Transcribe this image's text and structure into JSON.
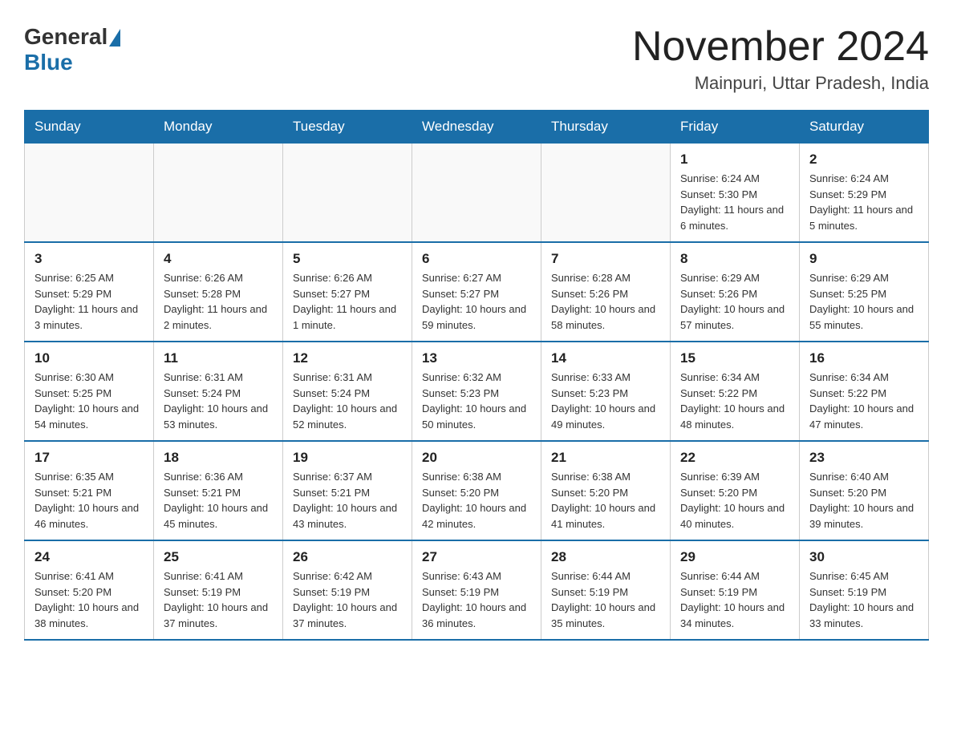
{
  "header": {
    "logo_general": "General",
    "logo_blue": "Blue",
    "month_title": "November 2024",
    "location": "Mainpuri, Uttar Pradesh, India"
  },
  "weekdays": [
    "Sunday",
    "Monday",
    "Tuesday",
    "Wednesday",
    "Thursday",
    "Friday",
    "Saturday"
  ],
  "weeks": [
    [
      {
        "day": "",
        "info": ""
      },
      {
        "day": "",
        "info": ""
      },
      {
        "day": "",
        "info": ""
      },
      {
        "day": "",
        "info": ""
      },
      {
        "day": "",
        "info": ""
      },
      {
        "day": "1",
        "info": "Sunrise: 6:24 AM\nSunset: 5:30 PM\nDaylight: 11 hours and 6 minutes."
      },
      {
        "day": "2",
        "info": "Sunrise: 6:24 AM\nSunset: 5:29 PM\nDaylight: 11 hours and 5 minutes."
      }
    ],
    [
      {
        "day": "3",
        "info": "Sunrise: 6:25 AM\nSunset: 5:29 PM\nDaylight: 11 hours and 3 minutes."
      },
      {
        "day": "4",
        "info": "Sunrise: 6:26 AM\nSunset: 5:28 PM\nDaylight: 11 hours and 2 minutes."
      },
      {
        "day": "5",
        "info": "Sunrise: 6:26 AM\nSunset: 5:27 PM\nDaylight: 11 hours and 1 minute."
      },
      {
        "day": "6",
        "info": "Sunrise: 6:27 AM\nSunset: 5:27 PM\nDaylight: 10 hours and 59 minutes."
      },
      {
        "day": "7",
        "info": "Sunrise: 6:28 AM\nSunset: 5:26 PM\nDaylight: 10 hours and 58 minutes."
      },
      {
        "day": "8",
        "info": "Sunrise: 6:29 AM\nSunset: 5:26 PM\nDaylight: 10 hours and 57 minutes."
      },
      {
        "day": "9",
        "info": "Sunrise: 6:29 AM\nSunset: 5:25 PM\nDaylight: 10 hours and 55 minutes."
      }
    ],
    [
      {
        "day": "10",
        "info": "Sunrise: 6:30 AM\nSunset: 5:25 PM\nDaylight: 10 hours and 54 minutes."
      },
      {
        "day": "11",
        "info": "Sunrise: 6:31 AM\nSunset: 5:24 PM\nDaylight: 10 hours and 53 minutes."
      },
      {
        "day": "12",
        "info": "Sunrise: 6:31 AM\nSunset: 5:24 PM\nDaylight: 10 hours and 52 minutes."
      },
      {
        "day": "13",
        "info": "Sunrise: 6:32 AM\nSunset: 5:23 PM\nDaylight: 10 hours and 50 minutes."
      },
      {
        "day": "14",
        "info": "Sunrise: 6:33 AM\nSunset: 5:23 PM\nDaylight: 10 hours and 49 minutes."
      },
      {
        "day": "15",
        "info": "Sunrise: 6:34 AM\nSunset: 5:22 PM\nDaylight: 10 hours and 48 minutes."
      },
      {
        "day": "16",
        "info": "Sunrise: 6:34 AM\nSunset: 5:22 PM\nDaylight: 10 hours and 47 minutes."
      }
    ],
    [
      {
        "day": "17",
        "info": "Sunrise: 6:35 AM\nSunset: 5:21 PM\nDaylight: 10 hours and 46 minutes."
      },
      {
        "day": "18",
        "info": "Sunrise: 6:36 AM\nSunset: 5:21 PM\nDaylight: 10 hours and 45 minutes."
      },
      {
        "day": "19",
        "info": "Sunrise: 6:37 AM\nSunset: 5:21 PM\nDaylight: 10 hours and 43 minutes."
      },
      {
        "day": "20",
        "info": "Sunrise: 6:38 AM\nSunset: 5:20 PM\nDaylight: 10 hours and 42 minutes."
      },
      {
        "day": "21",
        "info": "Sunrise: 6:38 AM\nSunset: 5:20 PM\nDaylight: 10 hours and 41 minutes."
      },
      {
        "day": "22",
        "info": "Sunrise: 6:39 AM\nSunset: 5:20 PM\nDaylight: 10 hours and 40 minutes."
      },
      {
        "day": "23",
        "info": "Sunrise: 6:40 AM\nSunset: 5:20 PM\nDaylight: 10 hours and 39 minutes."
      }
    ],
    [
      {
        "day": "24",
        "info": "Sunrise: 6:41 AM\nSunset: 5:20 PM\nDaylight: 10 hours and 38 minutes."
      },
      {
        "day": "25",
        "info": "Sunrise: 6:41 AM\nSunset: 5:19 PM\nDaylight: 10 hours and 37 minutes."
      },
      {
        "day": "26",
        "info": "Sunrise: 6:42 AM\nSunset: 5:19 PM\nDaylight: 10 hours and 37 minutes."
      },
      {
        "day": "27",
        "info": "Sunrise: 6:43 AM\nSunset: 5:19 PM\nDaylight: 10 hours and 36 minutes."
      },
      {
        "day": "28",
        "info": "Sunrise: 6:44 AM\nSunset: 5:19 PM\nDaylight: 10 hours and 35 minutes."
      },
      {
        "day": "29",
        "info": "Sunrise: 6:44 AM\nSunset: 5:19 PM\nDaylight: 10 hours and 34 minutes."
      },
      {
        "day": "30",
        "info": "Sunrise: 6:45 AM\nSunset: 5:19 PM\nDaylight: 10 hours and 33 minutes."
      }
    ]
  ]
}
